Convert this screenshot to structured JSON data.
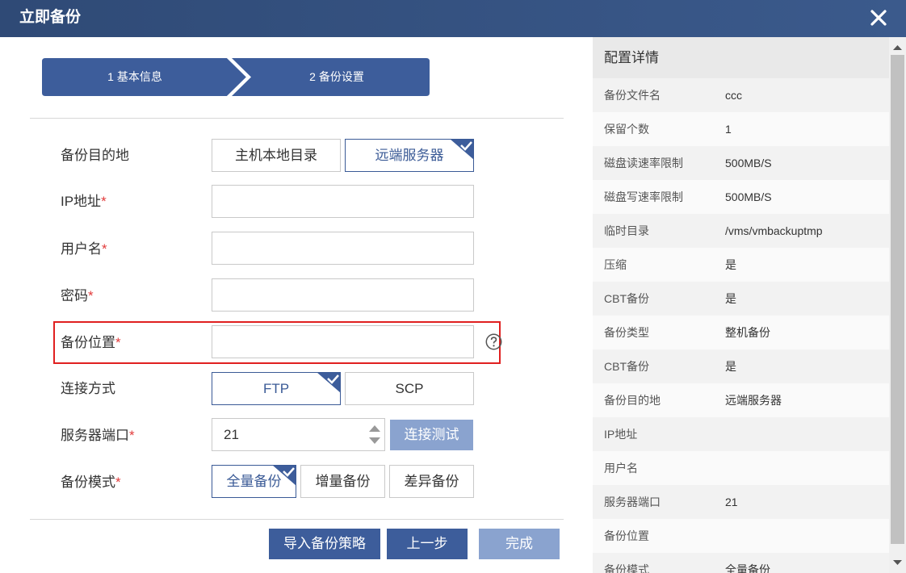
{
  "dialog": {
    "title": "立即备份"
  },
  "steps": [
    {
      "label": "1 基本信息"
    },
    {
      "label": "2 备份设置"
    }
  ],
  "form": {
    "destination": {
      "label": "备份目的地",
      "options": [
        "主机本地目录",
        "远端服务器"
      ],
      "selected": "远端服务器"
    },
    "ip": {
      "label": "IP地址",
      "required": "*",
      "value": ""
    },
    "username": {
      "label": "用户名",
      "required": "*",
      "value": ""
    },
    "password": {
      "label": "密码",
      "required": "*",
      "value": ""
    },
    "location": {
      "label": "备份位置",
      "required": "*",
      "value": ""
    },
    "connection": {
      "label": "连接方式",
      "options": [
        "FTP",
        "SCP"
      ],
      "selected": "FTP"
    },
    "port": {
      "label": "服务器端口",
      "required": "*",
      "value": "21",
      "test_button": "连接测试"
    },
    "mode": {
      "label": "备份模式",
      "required": "*",
      "options": [
        "全量备份",
        "增量备份",
        "差异备份"
      ],
      "selected": "全量备份"
    }
  },
  "footer": {
    "import_button": "导入备份策略",
    "prev_button": "上一步",
    "finish_button": "完成"
  },
  "details": {
    "title": "配置详情",
    "rows": [
      {
        "k": "备份文件名",
        "v": "ccc"
      },
      {
        "k": "保留个数",
        "v": "1"
      },
      {
        "k": "磁盘读速率限制",
        "v": "500MB/S"
      },
      {
        "k": "磁盘写速率限制",
        "v": "500MB/S"
      },
      {
        "k": "临时目录",
        "v": "/vms/vmbackuptmp"
      },
      {
        "k": "压缩",
        "v": "是"
      },
      {
        "k": "CBT备份",
        "v": "是"
      },
      {
        "k": "备份类型",
        "v": "整机备份"
      },
      {
        "k": "CBT备份",
        "v": "是"
      },
      {
        "k": "备份目的地",
        "v": "远端服务器"
      },
      {
        "k": "IP地址",
        "v": ""
      },
      {
        "k": "用户名",
        "v": ""
      },
      {
        "k": "服务器端口",
        "v": "21"
      },
      {
        "k": "备份位置",
        "v": ""
      },
      {
        "k": "备份模式",
        "v": "全量备份"
      }
    ]
  },
  "colors": {
    "titlebar": "#2f4a76",
    "accent": "#3d5d9b",
    "disabled": "#8aa3cf",
    "required": "#e23b3b",
    "highlight": "#e02020"
  },
  "icons": {
    "close": "close-icon",
    "help": "help-icon",
    "check": "check-icon",
    "spin_up": "chevron-up-icon",
    "spin_down": "chevron-down-icon"
  }
}
